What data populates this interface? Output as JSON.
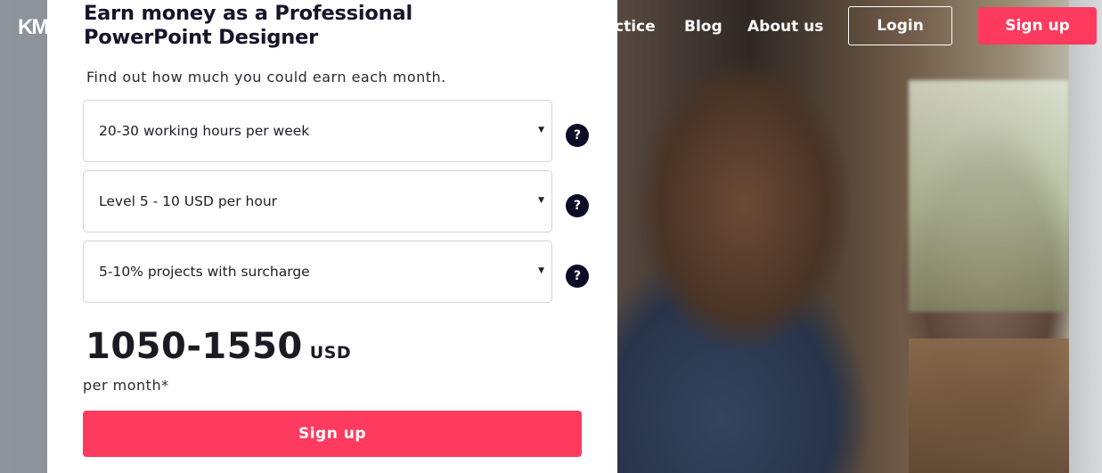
{
  "logo": {
    "text": "KM"
  },
  "nav": {
    "practice_label": "ctice",
    "blog_label": "Blog",
    "about_label": "About us",
    "login_label": "Login",
    "signup_label": "Sign up"
  },
  "calculator": {
    "title": "Earn money as a Professional PowerPoint Designer",
    "subtitle": "Find out how much you could earn each month.",
    "selects": {
      "hours": "20-30 working hours per week",
      "level": "Level 5 - 10 USD per hour",
      "surcharge": "5-10% projects with surcharge"
    },
    "caret": "▼",
    "help_symbol": "?",
    "amount": "1050-1550",
    "currency": "USD",
    "period": "per month*",
    "signup_label": "Sign up"
  },
  "colors": {
    "accent": "#fe3b5e",
    "help_bg": "#0c0c26"
  },
  "icons": {
    "logo": "km-logo",
    "caret": "caret-down-icon",
    "help": "question-mark-icon"
  }
}
